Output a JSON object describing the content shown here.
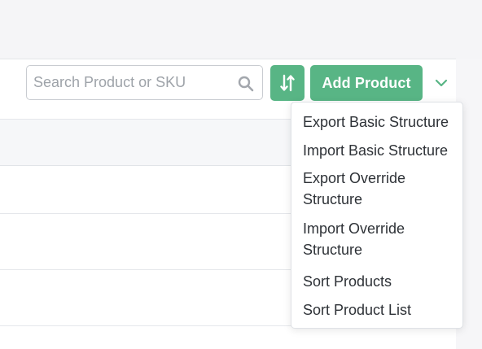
{
  "search": {
    "placeholder": "Search Product or SKU"
  },
  "toolbar": {
    "sort_icon": "sort-arrows-icon",
    "add_product_label": "Add Product",
    "dropdown_icon": "chevron-down-icon",
    "accent_color": "#58b585"
  },
  "menu": {
    "items": [
      {
        "label": "Export Basic Structure"
      },
      {
        "label": "Import Basic Structure"
      },
      {
        "label": "Export Override Structure"
      },
      {
        "label": "Import Override Structure"
      },
      {
        "label": "Sort Products"
      },
      {
        "label": "Sort Product List"
      }
    ]
  }
}
